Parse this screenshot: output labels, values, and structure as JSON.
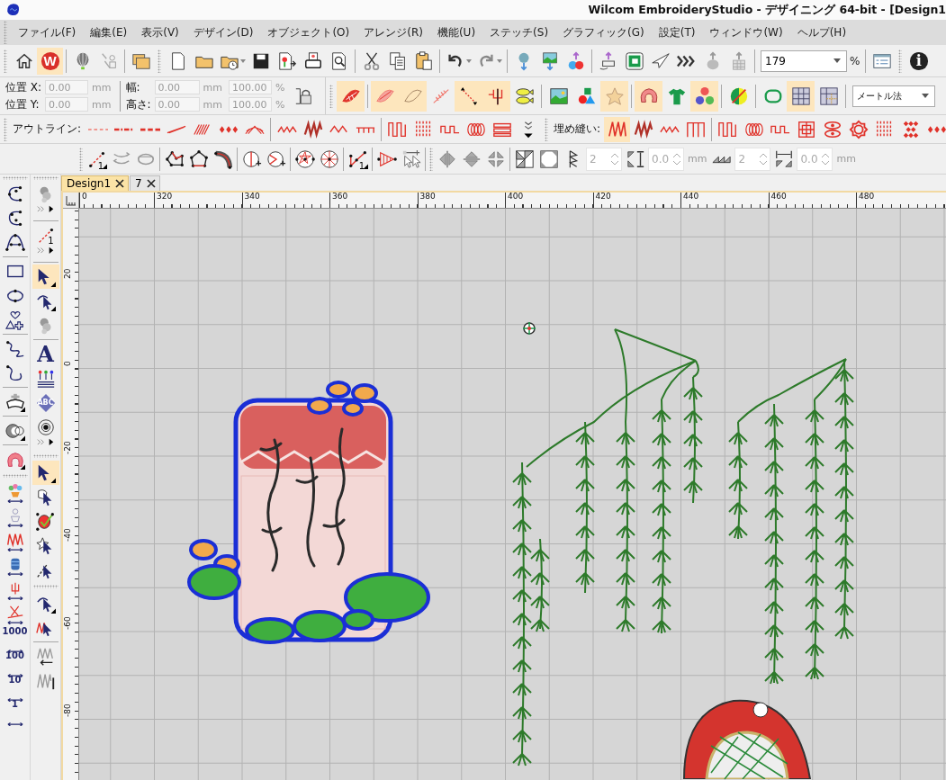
{
  "title_bar": {
    "title": "Wilcom EmbroideryStudio - デザイニング 64-bit - [Design1"
  },
  "menu": [
    {
      "label": "ファイル(F)"
    },
    {
      "label": "編集(E)"
    },
    {
      "label": "表示(V)"
    },
    {
      "label": "デザイン(D)"
    },
    {
      "label": "オブジェクト(O)"
    },
    {
      "label": "アレンジ(R)"
    },
    {
      "label": "機能(U)"
    },
    {
      "label": "ステッチ(S)"
    },
    {
      "label": "グラフィック(G)"
    },
    {
      "label": "設定(T)"
    },
    {
      "label": "ウィンドウ(W)"
    },
    {
      "label": "ヘルプ(H)"
    }
  ],
  "main_toolbar": {
    "tools": [
      {
        "kind": "home",
        "selected": false
      },
      {
        "kind": "logo",
        "text": "W",
        "selected": true
      },
      {
        "kind": "separator"
      },
      {
        "kind": "balloon",
        "selected": false
      },
      {
        "kind": "sketch",
        "selected": false
      },
      {
        "kind": "separator"
      },
      {
        "kind": "folders",
        "selected": false
      },
      {
        "kind": "grip"
      },
      {
        "kind": "doc",
        "selected": false
      },
      {
        "kind": "folder",
        "selected": false
      },
      {
        "kind": "folder-clock",
        "selected": false
      },
      {
        "kind": "save",
        "selected": false
      },
      {
        "kind": "export",
        "selected": false
      },
      {
        "kind": "printer",
        "selected": false
      },
      {
        "kind": "preview",
        "selected": false
      },
      {
        "kind": "separator"
      },
      {
        "kind": "scissors",
        "selected": false
      },
      {
        "kind": "copy",
        "selected": false
      },
      {
        "kind": "paste",
        "selected": false
      },
      {
        "kind": "separator"
      },
      {
        "kind": "undo",
        "selected": false
      },
      {
        "kind": "redo",
        "selected": false
      },
      {
        "kind": "separator"
      },
      {
        "kind": "down-globe",
        "selected": false
      },
      {
        "kind": "down-picture",
        "selected": false
      },
      {
        "kind": "ornaments",
        "selected": false
      },
      {
        "kind": "separator"
      },
      {
        "kind": "hoop-up",
        "selected": false
      },
      {
        "kind": "green-square",
        "selected": false
      },
      {
        "kind": "plane",
        "selected": false
      },
      {
        "kind": "chevrons",
        "selected": false
      },
      {
        "kind": "up-grey",
        "selected": false
      },
      {
        "kind": "up-grid",
        "selected": false
      },
      {
        "kind": "separator"
      }
    ],
    "zoom": {
      "value": "179",
      "unit": "%"
    },
    "tools_after": [
      {
        "kind": "separator"
      },
      {
        "kind": "checklist"
      },
      {
        "kind": "grip"
      },
      {
        "kind": "info",
        "text": "i",
        "selected": false
      }
    ]
  },
  "transform_bar": {
    "position": [
      {
        "label": "位置 X:",
        "value": "0.00",
        "unit": "mm",
        "disabled": true
      },
      {
        "label": "位置 Y:",
        "value": "0.00",
        "unit": "mm",
        "disabled": true
      }
    ],
    "size": [
      {
        "label": "幅:",
        "value": "0.00",
        "unit": "mm",
        "scale": "100.00",
        "scale_unit": "%",
        "disabled": true
      },
      {
        "label": "高さ:",
        "value": "0.00",
        "unit": "mm",
        "scale": "100.00",
        "scale_unit": "%",
        "disabled": true
      }
    ]
  },
  "stitch_toolbar": {
    "tools": [
      {
        "kind": "grip"
      },
      {
        "kind": "red-leaf",
        "selected": true
      },
      {
        "kind": "separator"
      },
      {
        "kind": "red-leaf-light",
        "selected": true
      },
      {
        "kind": "leaf-outline",
        "selected": true
      },
      {
        "kind": "feather",
        "selected": false
      },
      {
        "kind": "dotted-line",
        "selected": true
      },
      {
        "kind": "fork",
        "selected": true
      },
      {
        "kind": "fish",
        "selected": false
      },
      {
        "kind": "separator"
      },
      {
        "kind": "picture",
        "selected": false
      },
      {
        "kind": "shapes",
        "selected": false
      },
      {
        "kind": "star",
        "selected": true
      },
      {
        "kind": "separator"
      },
      {
        "kind": "pink-blob",
        "selected": true
      },
      {
        "kind": "tshirt",
        "selected": false
      },
      {
        "kind": "balls",
        "selected": true
      },
      {
        "kind": "separator"
      },
      {
        "kind": "green-yellow",
        "selected": false
      },
      {
        "kind": "separator"
      },
      {
        "kind": "hoop",
        "selected": false
      },
      {
        "kind": "grid",
        "selected": true
      },
      {
        "kind": "grid-ruler",
        "selected": false
      },
      {
        "kind": "separator"
      }
    ],
    "units": {
      "value": "メートル法"
    }
  },
  "outline_bar": {
    "label": "アウトライン:",
    "tools": [
      {
        "kind": "o-dash",
        "selected": false
      },
      {
        "kind": "o-dashdot",
        "selected": false
      },
      {
        "kind": "o-bigdash",
        "selected": false
      },
      {
        "kind": "o-z",
        "selected": false
      },
      {
        "kind": "o-zz",
        "selected": false
      },
      {
        "kind": "o-diamonds",
        "selected": false
      },
      {
        "kind": "o-fan",
        "selected": false
      },
      {
        "kind": "separator"
      },
      {
        "kind": "zig",
        "selected": false
      },
      {
        "kind": "zig-thick",
        "selected": false
      },
      {
        "kind": "wave",
        "selected": false
      },
      {
        "kind": "comb",
        "selected": false
      },
      {
        "kind": "separator"
      },
      {
        "kind": "sq-tall",
        "selected": false
      },
      {
        "kind": "hatchv",
        "selected": false
      },
      {
        "kind": "sq",
        "selected": false
      },
      {
        "kind": "rings",
        "selected": false
      },
      {
        "kind": "bars",
        "selected": false
      },
      {
        "kind": "more"
      }
    ]
  },
  "fill_bar": {
    "label": "埋め縫い:",
    "tools": [
      {
        "kind": "zig-tall",
        "selected": true
      },
      {
        "kind": "zig-thick",
        "selected": false
      },
      {
        "kind": "zig",
        "selected": false
      },
      {
        "kind": "comb-tall",
        "selected": false
      },
      {
        "kind": "separator"
      },
      {
        "kind": "sq-tall",
        "selected": false
      },
      {
        "kind": "rings",
        "selected": false
      },
      {
        "kind": "sq",
        "selected": false
      },
      {
        "kind": "maze",
        "selected": false
      },
      {
        "kind": "ovals",
        "selected": false
      },
      {
        "kind": "flower",
        "selected": false
      },
      {
        "kind": "hatchv",
        "selected": false
      },
      {
        "kind": "diamond-grid",
        "selected": false
      },
      {
        "kind": "o-diamonds",
        "selected": false
      }
    ]
  },
  "reshape_bar": {
    "tools": [
      {
        "kind": "grip"
      },
      {
        "kind": "line-nodes",
        "text": "1"
      },
      {
        "kind": "rotate-grey"
      },
      {
        "kind": "rotate-circle-grey"
      },
      {
        "kind": "separator"
      },
      {
        "kind": "poly-nodes"
      },
      {
        "kind": "pent-nodes"
      },
      {
        "kind": "arc-nodes"
      },
      {
        "kind": "separator"
      },
      {
        "kind": "circle-split"
      },
      {
        "kind": "circle-cut"
      },
      {
        "kind": "separator"
      },
      {
        "kind": "star-circle"
      },
      {
        "kind": "wheel-circle"
      },
      {
        "kind": "separator"
      },
      {
        "kind": "zig-nodes",
        "text": "1"
      },
      {
        "kind": "separator"
      },
      {
        "kind": "triangle-lines"
      },
      {
        "kind": "pointer-plus"
      },
      {
        "kind": "separator"
      },
      {
        "kind": "grip"
      },
      {
        "kind": "flip-h"
      },
      {
        "kind": "flip-v"
      },
      {
        "kind": "flip-4"
      },
      {
        "kind": "separator"
      },
      {
        "kind": "tri-grid"
      },
      {
        "kind": "tri-square"
      },
      {
        "kind": "zig-vert"
      },
      {
        "kind": "spinner",
        "value": "2",
        "disabled": true
      },
      {
        "kind": "gap"
      },
      {
        "kind": "spinner",
        "value": "0.0",
        "unit": "mm",
        "disabled": true
      },
      {
        "kind": "sawtooth"
      },
      {
        "kind": "spinner",
        "value": "2",
        "disabled": true
      },
      {
        "kind": "width-gap"
      },
      {
        "kind": "spinner",
        "value": "0.0",
        "unit": "mm",
        "disabled": true
      }
    ]
  },
  "document_tabs": [
    {
      "label": "Design1",
      "selected": true
    },
    {
      "label": "7",
      "selected": false
    }
  ],
  "left_toolbox": {
    "column_1": [
      {
        "kind": "curve-nodes",
        "selected": false
      },
      {
        "kind": "curve-nodes-2",
        "selected": false
      },
      {
        "kind": "arch-nodes",
        "selected": false
      },
      {
        "kind": "separator"
      },
      {
        "kind": "rect",
        "selected": false
      },
      {
        "kind": "ellipse-nodes",
        "selected": false
      },
      {
        "kind": "shapes-outline",
        "selected": false
      },
      {
        "kind": "separator"
      },
      {
        "kind": "squiggle",
        "selected": false
      },
      {
        "kind": "hook",
        "selected": false
      },
      {
        "kind": "separator"
      },
      {
        "kind": "crown",
        "selected": false
      },
      {
        "kind": "separator"
      },
      {
        "kind": "crescent",
        "selected": false
      },
      {
        "kind": "separator"
      },
      {
        "kind": "pink-ring",
        "selected": false
      },
      {
        "kind": "grip"
      },
      {
        "kind": "flowers-pot",
        "selected": false
      },
      {
        "kind": "flowers-pot-light",
        "selected": false
      },
      {
        "kind": "zig-red-arrows",
        "selected": false
      },
      {
        "kind": "spool",
        "selected": false
      },
      {
        "kind": "fork-small",
        "selected": false
      },
      {
        "kind": "scissors-red",
        "selected": false
      },
      {
        "kind": "count",
        "text": "1000",
        "selected": false
      },
      {
        "kind": "count",
        "text": "100",
        "selected": false
      },
      {
        "kind": "count",
        "text": "10",
        "selected": false
      },
      {
        "kind": "count",
        "text": "1",
        "selected": false
      }
    ],
    "column_2": [
      {
        "kind": "balloon-grey",
        "selected": false
      },
      {
        "kind": "expand"
      },
      {
        "kind": "separator"
      },
      {
        "kind": "line-node-red",
        "text": "1",
        "selected": false
      },
      {
        "kind": "expand"
      },
      {
        "kind": "separator"
      },
      {
        "kind": "arrow-select",
        "selected": true
      },
      {
        "kind": "node-arrow",
        "selected": false
      },
      {
        "kind": "balloon-grey",
        "selected": false
      },
      {
        "kind": "separator"
      },
      {
        "kind": "letter",
        "text": "A",
        "selected": false
      },
      {
        "kind": "people",
        "selected": false
      },
      {
        "kind": "abc-diamond",
        "text": "ABC",
        "selected": false
      },
      {
        "kind": "target",
        "selected": false
      },
      {
        "kind": "expand"
      },
      {
        "kind": "grip"
      },
      {
        "kind": "arrow-select",
        "selected": true
      },
      {
        "kind": "pointer-tag",
        "selected": false
      },
      {
        "kind": "check-tag"
      },
      {
        "kind": "star-pointer",
        "selected": false
      },
      {
        "kind": "dash-pointer",
        "selected": false
      },
      {
        "kind": "grip"
      },
      {
        "kind": "node-arrow",
        "selected": false
      },
      {
        "kind": "zig-pointer",
        "selected": false
      },
      {
        "kind": "separator"
      },
      {
        "kind": "zig-return-grey",
        "selected": false
      },
      {
        "kind": "zig-bar-grey",
        "selected": false
      }
    ]
  },
  "rulers": {
    "horizontal": [
      "0",
      "320",
      "340",
      "360",
      "380",
      "400",
      "420",
      "440",
      "460",
      "480"
    ],
    "vertical": [
      "20",
      "0",
      "-20",
      "-40",
      "-60",
      "-80"
    ]
  }
}
